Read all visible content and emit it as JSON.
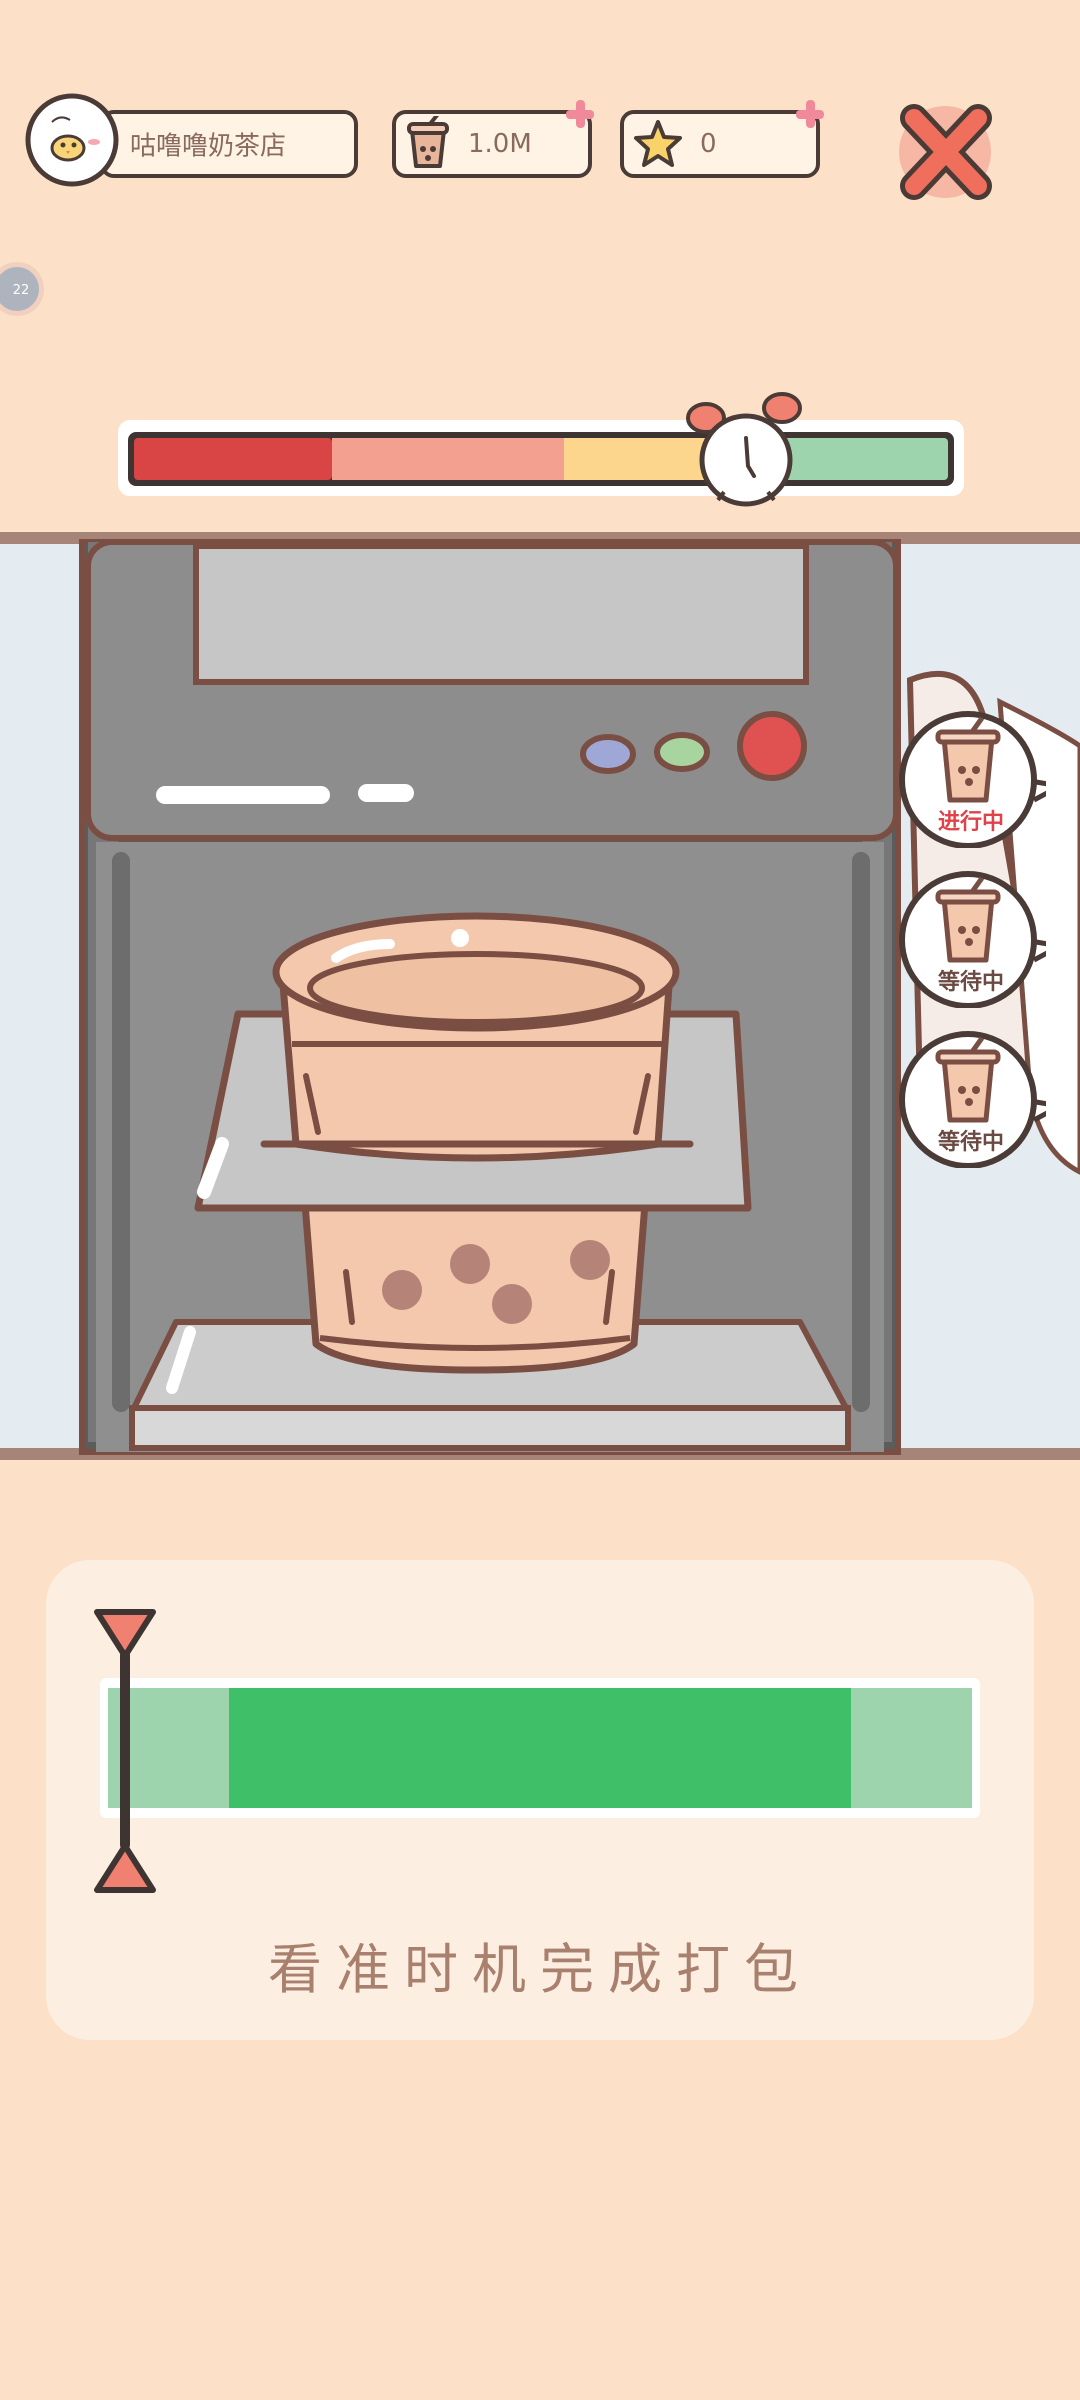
{
  "top_bar": {
    "shop_name": "咕噜噜奶茶店",
    "coins": "1.0M",
    "stars": "0",
    "avatar_icon": "chick-avatar-icon",
    "coin_icon": "milk-tea-cup-icon",
    "star_icon": "star-icon",
    "close_icon": "close-x-icon"
  },
  "side_badge": "22",
  "timer_bar": {
    "segment_colors": [
      "#d94545",
      "#f4a090",
      "#fbd68c",
      "#9dd4ae"
    ],
    "icon": "alarm-clock-icon"
  },
  "orders": [
    {
      "status": "进行中",
      "color": "#e0424a"
    },
    {
      "status": "等待中",
      "color": "#6a4a42"
    },
    {
      "status": "等待中",
      "color": "#6a4a42"
    }
  ],
  "packing_meter": {
    "colors": {
      "zone": "#3fbf68",
      "track": "#9dd4ae"
    },
    "green_zone_start": 0.14,
    "green_zone_end": 0.86,
    "marker_position": 0.02
  },
  "hint": "看准时机完成打包"
}
